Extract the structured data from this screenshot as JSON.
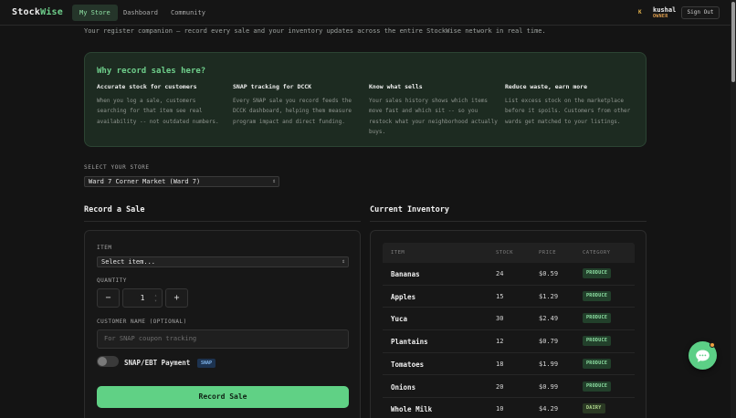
{
  "header": {
    "brand_main": "Stock",
    "brand_accent": "Wise",
    "tabs": [
      {
        "label": "My Store",
        "active": true
      },
      {
        "label": "Dashboard",
        "active": false
      },
      {
        "label": "Community",
        "active": false
      }
    ],
    "user_initial": "K",
    "user_name": "kushal",
    "user_role": "OWNER",
    "sign_out": "Sign Out"
  },
  "tagline": "Your register companion — record every sale and your inventory updates across the entire StockWise network in real time.",
  "why": {
    "title": "Why record sales here?",
    "columns": [
      {
        "title": "Accurate stock for customers",
        "body": "When you log a sale, customers searching for that item see real availability -- not outdated numbers."
      },
      {
        "title": "SNAP tracking for DCCK",
        "body": "Every SNAP sale you record feeds the DCCK dashboard, helping them measure program impact and direct funding."
      },
      {
        "title": "Know what sells",
        "body": "Your sales history shows which items move fast and which sit -- so you restock what your neighborhood actually buys."
      },
      {
        "title": "Reduce waste, earn more",
        "body": "List excess stock on the marketplace before it spoils. Customers from other wards get matched to your listings."
      }
    ]
  },
  "store": {
    "label": "SELECT YOUR STORE",
    "selected": "Ward 7 Corner Market (Ward 7)"
  },
  "sale": {
    "title": "Record a Sale",
    "item_label": "ITEM",
    "item_value": "Select item...",
    "quantity_label": "QUANTITY",
    "quantity_value": "1",
    "minus": "−",
    "plus": "+",
    "customer_label": "CUSTOMER NAME (OPTIONAL)",
    "customer_placeholder": "For SNAP coupon tracking",
    "snap_label": "SNAP/EBT Payment",
    "snap_badge": "SNAP",
    "snap_enabled": false,
    "submit": "Record Sale"
  },
  "inventory": {
    "title": "Current Inventory",
    "columns": [
      "ITEM",
      "STOCK",
      "PRICE",
      "CATEGORY"
    ],
    "rows": [
      {
        "item": "Bananas",
        "stock": "24",
        "price": "$0.59",
        "category": "PRODUCE"
      },
      {
        "item": "Apples",
        "stock": "15",
        "price": "$1.29",
        "category": "PRODUCE"
      },
      {
        "item": "Yuca",
        "stock": "30",
        "price": "$2.49",
        "category": "PRODUCE"
      },
      {
        "item": "Plantains",
        "stock": "12",
        "price": "$0.79",
        "category": "PRODUCE"
      },
      {
        "item": "Tomatoes",
        "stock": "18",
        "price": "$1.99",
        "category": "PRODUCE"
      },
      {
        "item": "Onions",
        "stock": "20",
        "price": "$0.99",
        "category": "PRODUCE"
      },
      {
        "item": "Whole Milk",
        "stock": "10",
        "price": "$4.29",
        "category": "DAIRY"
      }
    ]
  },
  "icons": {
    "chat": "chat-bubble-icon",
    "chevron": "chevron-up-down-icon"
  },
  "colors": {
    "accent": "#6fd08c",
    "button": "#60d185",
    "background": "#141414"
  }
}
